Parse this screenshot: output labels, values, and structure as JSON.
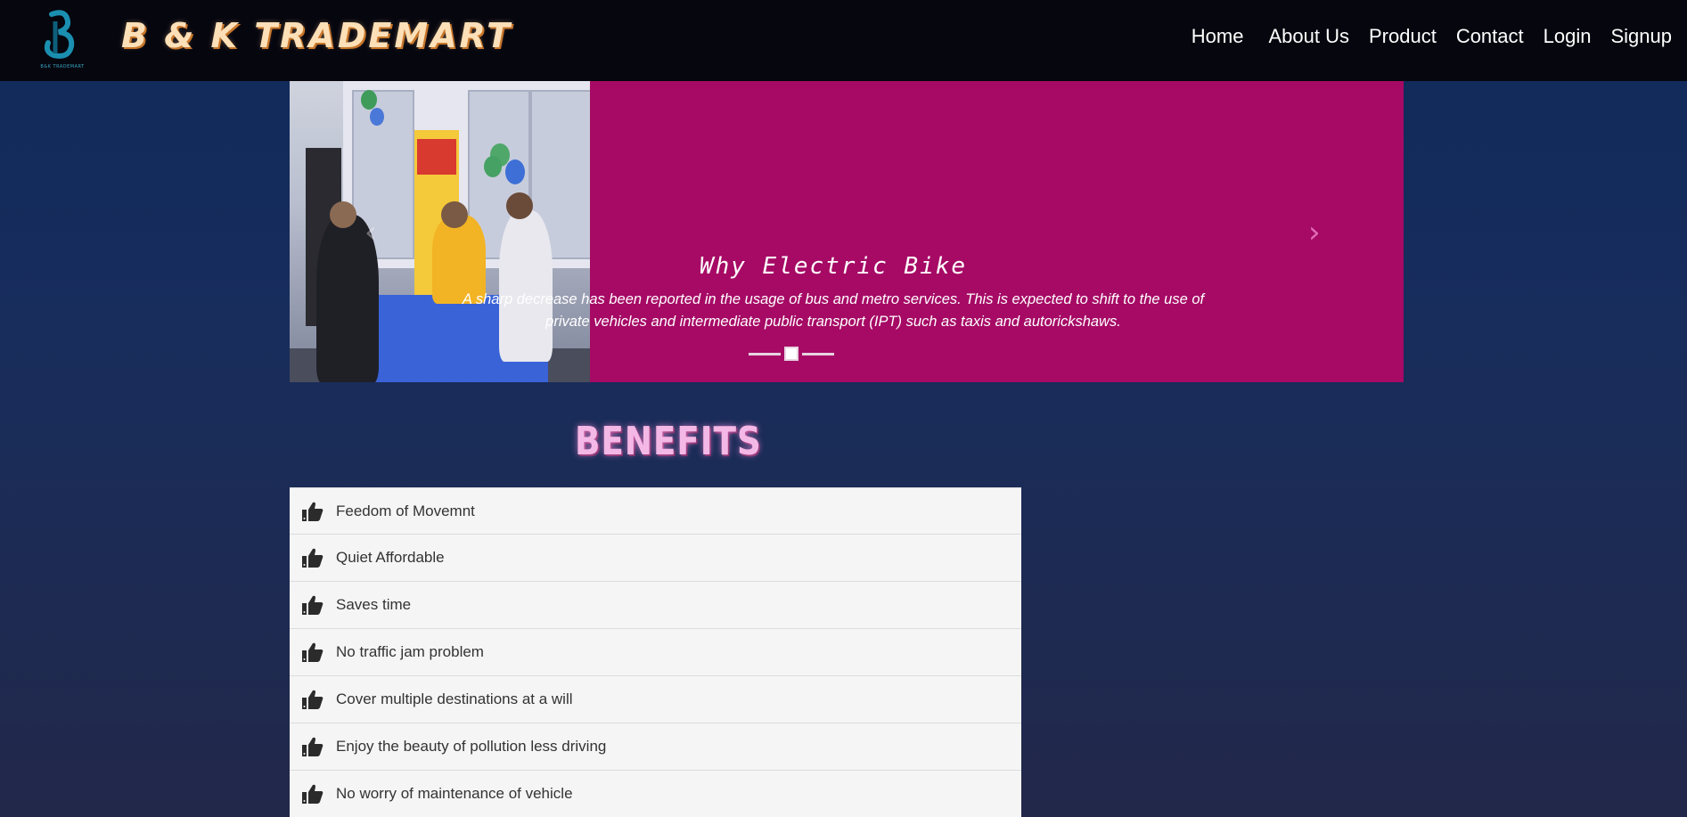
{
  "navbar": {
    "logo_tag": "B&K TRADEMART",
    "brand": "B & K TRADEMART",
    "links": [
      "Home",
      "About Us",
      "Product",
      "Contact",
      "Login",
      "Signup"
    ]
  },
  "carousel": {
    "title": "Why Electric Bike",
    "text": "A sharp decrease has been reported in the usage of bus and metro services. This is expected to shift to the use of private vehicles and intermediate public transport (IPT) such as taxis and autorickshaws.",
    "prev_icon": "chevron-left-icon",
    "next_icon": "chevron-right-icon",
    "background_color": "#a60a65"
  },
  "benefits": {
    "title": "BENEFITS",
    "items": [
      "Feedom of Movemnt",
      "Quiet Affordable",
      "Saves time",
      "No traffic jam problem",
      "Cover multiple destinations at a will",
      "Enjoy the beauty of pollution less driving",
      "No worry of maintenance of vehicle"
    ]
  }
}
